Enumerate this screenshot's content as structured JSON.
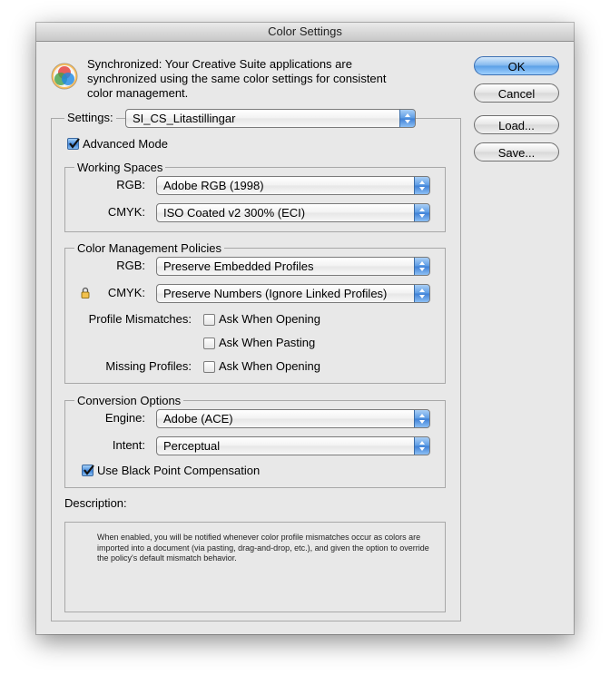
{
  "window": {
    "title": "Color Settings"
  },
  "sync": {
    "icon": "color-wheel-icon",
    "message": "Synchronized: Your Creative Suite applications are synchronized using the same color settings for consistent color management."
  },
  "buttons": {
    "ok": "OK",
    "cancel": "Cancel",
    "load": "Load...",
    "save": "Save..."
  },
  "settings": {
    "label": "Settings:",
    "value": "SI_CS_Litastillingar"
  },
  "advanced_mode": {
    "label": "Advanced Mode",
    "checked": true
  },
  "working_spaces": {
    "title": "Working Spaces",
    "rgb_label": "RGB:",
    "rgb_value": "Adobe RGB (1998)",
    "cmyk_label": "CMYK:",
    "cmyk_value": "ISO Coated v2 300% (ECI)"
  },
  "policies": {
    "title": "Color Management Policies",
    "rgb_label": "RGB:",
    "rgb_value": "Preserve Embedded Profiles",
    "cmyk_label": "CMYK:",
    "cmyk_value": "Preserve Numbers (Ignore Linked Profiles)",
    "cmyk_icon": "lock-icon",
    "mismatch_label": "Profile Mismatches:",
    "ask_opening": {
      "label": "Ask When Opening",
      "checked": false
    },
    "ask_pasting": {
      "label": "Ask When Pasting",
      "checked": false
    },
    "missing_label": "Missing Profiles:",
    "missing_ask_opening": {
      "label": "Ask When Opening",
      "checked": false
    }
  },
  "conversion": {
    "title": "Conversion Options",
    "engine_label": "Engine:",
    "engine_value": "Adobe (ACE)",
    "intent_label": "Intent:",
    "intent_value": "Perceptual",
    "bpc": {
      "label": "Use Black Point Compensation",
      "checked": true
    }
  },
  "description": {
    "label": "Description:",
    "text": "When enabled, you will be notified whenever color profile mismatches occur as colors are imported into a document (via pasting, drag-and-drop, etc.), and given the option to override the policy's default mismatch behavior."
  }
}
